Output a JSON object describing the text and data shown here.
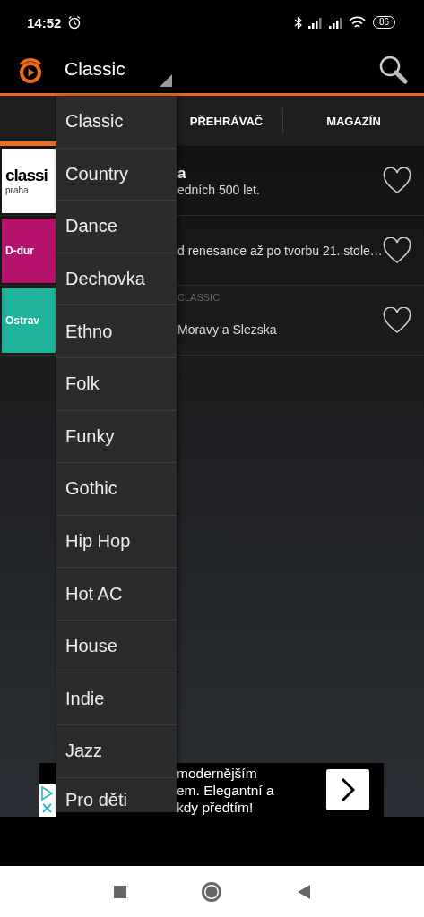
{
  "status_bar": {
    "time": "14:52",
    "battery": "86"
  },
  "app_bar": {
    "spinner_value": "Classic"
  },
  "tabs": [
    {
      "selected": true
    },
    {
      "label": "PŘEHRÁVAČ",
      "selected": false
    },
    {
      "label": "MAGAZÍN",
      "selected": false
    }
  ],
  "stations": [
    {
      "logo_text": "classi",
      "logo_subtext": "praha",
      "color": "#ffffff",
      "title": "a",
      "subtitle": "edních 500 let.",
      "favorite": false
    },
    {
      "logo_text": "D-dur",
      "color": "#b5136b",
      "subtitle": "d renesance až po tvorbu 21. stole…",
      "favorite": false
    },
    {
      "logo_text": "Ostrav",
      "color": "#1fb39b",
      "overline": "CLASSIC",
      "subtitle": "Moravy a Slezska",
      "favorite": false
    }
  ],
  "dropdown": {
    "items": [
      "Classic",
      "Country",
      "Dance",
      "Dechovka",
      "Ethno",
      "Folk",
      "Funky",
      "Gothic",
      "Hip Hop",
      "Hot AC",
      "House",
      "Indie",
      "Jazz",
      "Pro děti"
    ]
  },
  "ad": {
    "lines": [
      "modernějším",
      "em. Elegantní a",
      "kdy předtím!"
    ]
  }
}
